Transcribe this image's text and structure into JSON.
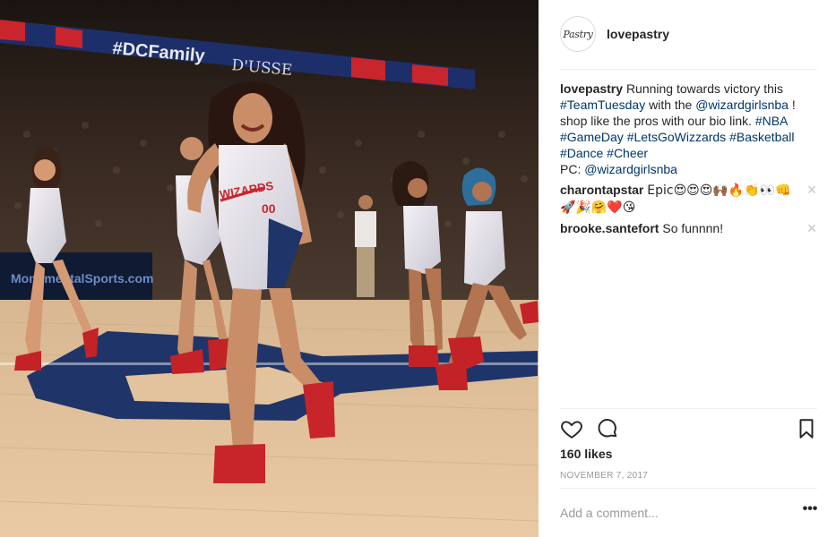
{
  "post": {
    "username": "lovepastry",
    "avatar_text": "Pastry",
    "caption": {
      "author": "lovepastry",
      "text_1": "Running towards victory this",
      "tag_1": "#TeamTuesday",
      "text_2": "with the",
      "tag_2": "@wizardgirlsnba",
      "text_3": "! shop like the pros with our bio link.",
      "tag_3": "#NBA",
      "tag_4": "#GameDay",
      "tag_5": "#LetsGoWizzards",
      "tag_6": "#Basketball",
      "tag_7": "#Dance",
      "tag_8": "#Cheer",
      "pc_label": "PC:",
      "tag_9": "@wizardgirlsnba"
    },
    "comments": [
      {
        "author": "charontapstar",
        "text": "Epic😍😍😍🙌🏾🔥👏👀👊🚀🎉🤗❤️😘"
      },
      {
        "author": "brooke.santefort",
        "text": "So funnnn!"
      }
    ],
    "likes": "160 likes",
    "date": "NOVEMBER 7, 2017",
    "add_comment_placeholder": "Add a comment...",
    "more_label": "•••"
  },
  "photo": {
    "banner_text_1": "#DCFamily",
    "banner_text_2": "D'USSE",
    "courtside_text": "MonumentalSports.com",
    "uniform_text": "WIZARDS",
    "uniform_number": "00"
  },
  "icons": {
    "heart": "heart-icon",
    "comment": "comment-icon",
    "bookmark": "bookmark-icon",
    "close": "close-icon",
    "more": "more-icon"
  },
  "colors": {
    "link": "#003569",
    "muted": "#999999",
    "divider": "#efefef"
  }
}
